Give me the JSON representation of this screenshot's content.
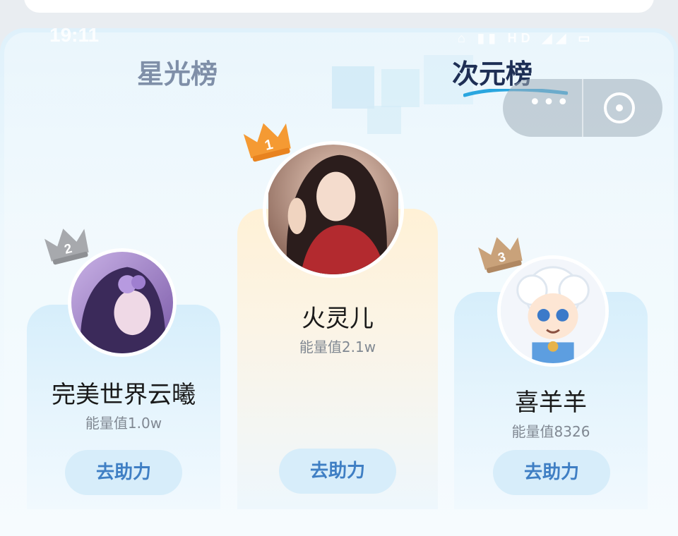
{
  "status_bar": {
    "time": "19:11",
    "icons": "⌂ ▮▮ HD ◢◢ ▭"
  },
  "tabs": [
    {
      "label": "星光榜",
      "active": false
    },
    {
      "label": "次元榜",
      "active": true
    }
  ],
  "capsule": {
    "more_icon": "more-dots-icon",
    "more_glyph": "•••",
    "close_icon": "close-circle-icon"
  },
  "leaderboard": {
    "first": {
      "rank": "1",
      "name": "火灵儿",
      "energy": "能量值2.1w",
      "button": "去助力"
    },
    "second": {
      "rank": "2",
      "name": "完美世界云曦",
      "energy": "能量值1.0w",
      "button": "去助力"
    },
    "third": {
      "rank": "3",
      "name": "喜羊羊",
      "energy": "能量值8326",
      "button": "去助力"
    }
  },
  "colors": {
    "crown_gold": "#f59a33",
    "crown_silver": "#a7a9ad",
    "crown_bronze": "#c9a27a",
    "button_text": "#3f7fc4",
    "button_bg": "#d7edfa",
    "active_tab": "#1e2f55",
    "inactive_tab": "#7f8fa8"
  }
}
